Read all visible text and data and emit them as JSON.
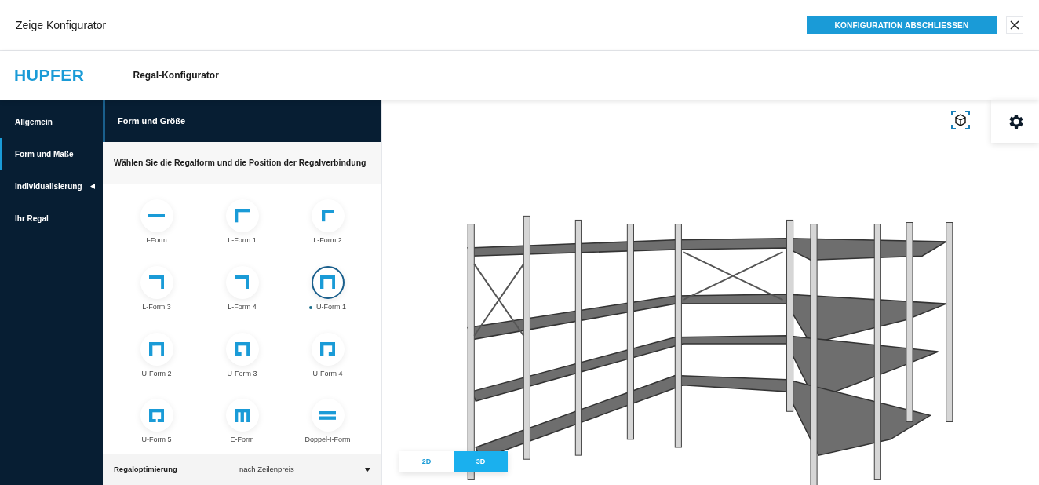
{
  "window": {
    "title": "Zeige Konfigurator",
    "primary_button": "KONFIGURATION ABSCHLIESSEN"
  },
  "header": {
    "logo": "HUPFER",
    "title": "Regal-Konfigurator"
  },
  "sidebar": {
    "items": [
      {
        "label": "Allgemein",
        "selected": false,
        "has_submenu": false
      },
      {
        "label": "Form und Maße",
        "selected": true,
        "has_submenu": false
      },
      {
        "label": "Individualisierung",
        "selected": false,
        "has_submenu": true
      },
      {
        "label": "Ihr Regal",
        "selected": false,
        "has_submenu": false
      }
    ]
  },
  "panel": {
    "title": "Form und Größe",
    "instruction": "Wählen Sie die Regalform und die Position der Regalverbindung",
    "shapes": [
      {
        "label": "I-Form",
        "kind": "i",
        "selected": false
      },
      {
        "label": "L-Form 1",
        "kind": "l1",
        "selected": false
      },
      {
        "label": "L-Form 2",
        "kind": "l2",
        "selected": false
      },
      {
        "label": "L-Form 3",
        "kind": "l3",
        "selected": false
      },
      {
        "label": "L-Form 4",
        "kind": "l4",
        "selected": false
      },
      {
        "label": "U-Form 1",
        "kind": "u1",
        "selected": true
      },
      {
        "label": "U-Form 2",
        "kind": "u2",
        "selected": false
      },
      {
        "label": "U-Form 3",
        "kind": "u3",
        "selected": false
      },
      {
        "label": "U-Form 4",
        "kind": "u4",
        "selected": false
      },
      {
        "label": "U-Form 5",
        "kind": "u5",
        "selected": false
      },
      {
        "label": "E-Form",
        "kind": "e",
        "selected": false
      },
      {
        "label": "Doppel-I-Form",
        "kind": "double-i",
        "selected": false
      }
    ],
    "optimization": {
      "label": "Regaloptimierung",
      "value": "nach Zeilenpreis"
    }
  },
  "viewer": {
    "view_modes": [
      {
        "label": "2D",
        "selected": false
      },
      {
        "label": "3D",
        "selected": true
      }
    ]
  }
}
